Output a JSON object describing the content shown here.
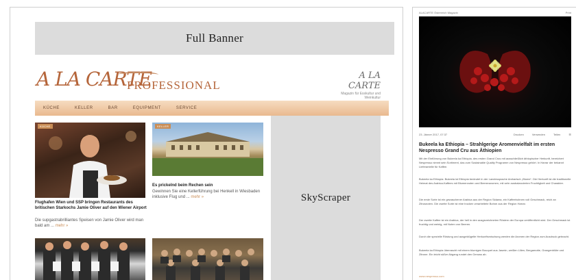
{
  "left": {
    "full_banner_label": "Full Banner",
    "skyscraper_label": "SkyScraper",
    "logo": {
      "main": "A LA CARTE",
      "sub": "PROFESSIONAL",
      "small_main": "A LA CARTE",
      "small_sub": "Magazin für Esskultur und Weinkultur"
    },
    "nav": [
      "KÜCHE",
      "KELLER",
      "BAR",
      "EQUIPMENT",
      "SERVICE"
    ],
    "articles": [
      {
        "tag": "KÜCHE",
        "title": "Flughafen Wien und SSP bringen Restaurants des britischen Starkochs Jamie Oliver auf den Wiener Airport",
        "text": "Die supgastrabrilliantes Speisen von Jamie Oliver wird man bald am ...",
        "more": "mehr »"
      },
      {
        "tag": "KELLER",
        "title": "Es prickelnd beim Rechen sein",
        "text": "Gewinnen Sie eine Kellerführung bei Henkell in Wiesbaden inklusive Flug und ...",
        "more": "mehr »"
      },
      {
        "tag": "",
        "title": "",
        "text": "",
        "more": ""
      },
      {
        "tag": "",
        "title": "",
        "text": "",
        "more": ""
      }
    ]
  },
  "right": {
    "top_left": "ALACARTE Österreich Magazin",
    "top_right": "Print",
    "meta_left": "23. Jänner 2017, 07:37",
    "meta_items": [
      "Drucken",
      "Versenden",
      "Teilen"
    ],
    "title": "Bukeela ka Ethiopia – Strahlgerige Aromenvielfalt im ersten Nespresso Grand Cru aus Äthiopien",
    "paragraphs": [
      "Mit der Einführung von Bukeela ka Ethiopia, des ersten Grand Crus mit ausschließlich äthiopischer Herkunft, bereichert Nespresso nimmt sein Sortiment, das zum Sustainable Quality Programm von Nespresso gehört. In Harrar der bekannt Lieferantelle für Kaffee.",
      "Bukeela ka Ethiopia: Bukeela ist Ethiopia bedeutet in der Landessprache Amharisch „Blume“. Die Herkunft ist die traditionelle Heimat des Arabica-Kaffees mit Blumennoten und Beerenaromen, mit sehr ausbalancierten Fruchtigkeit und Charakter.",
      "Die erste Sorte ist ein gewaschener Arabica aus der Region Sidama, ein Kaffeebohnen voll Geschmack, reich an Zitrusnoten. Die zweite Sorte ist eine trocken verarbeitete Bohne aus der Region Harrar.",
      "Der zweite Kaffee ist ein Arabica, der hell in den ausgezeichneten Röstern der Europa veröffentlicht wird. Der Geschmack ist fruchtig und weinig, mit Noten von Beeren.",
      "Durch die spezielle Röstung und ausgeklügelte Herkunftsmischung werden die Aromen der Region zum Ausdruck gebracht.",
      "Bukeela ka Ethiopia überrascht mit einem blumigen Bouquet aus Jasmin, weißen Lilien, Bergamotte, Orangenblüte und Zitrone. Ein leicht süßer Abgang rundet den Genuss ab."
    ],
    "link": "www.nespresso.com"
  }
}
